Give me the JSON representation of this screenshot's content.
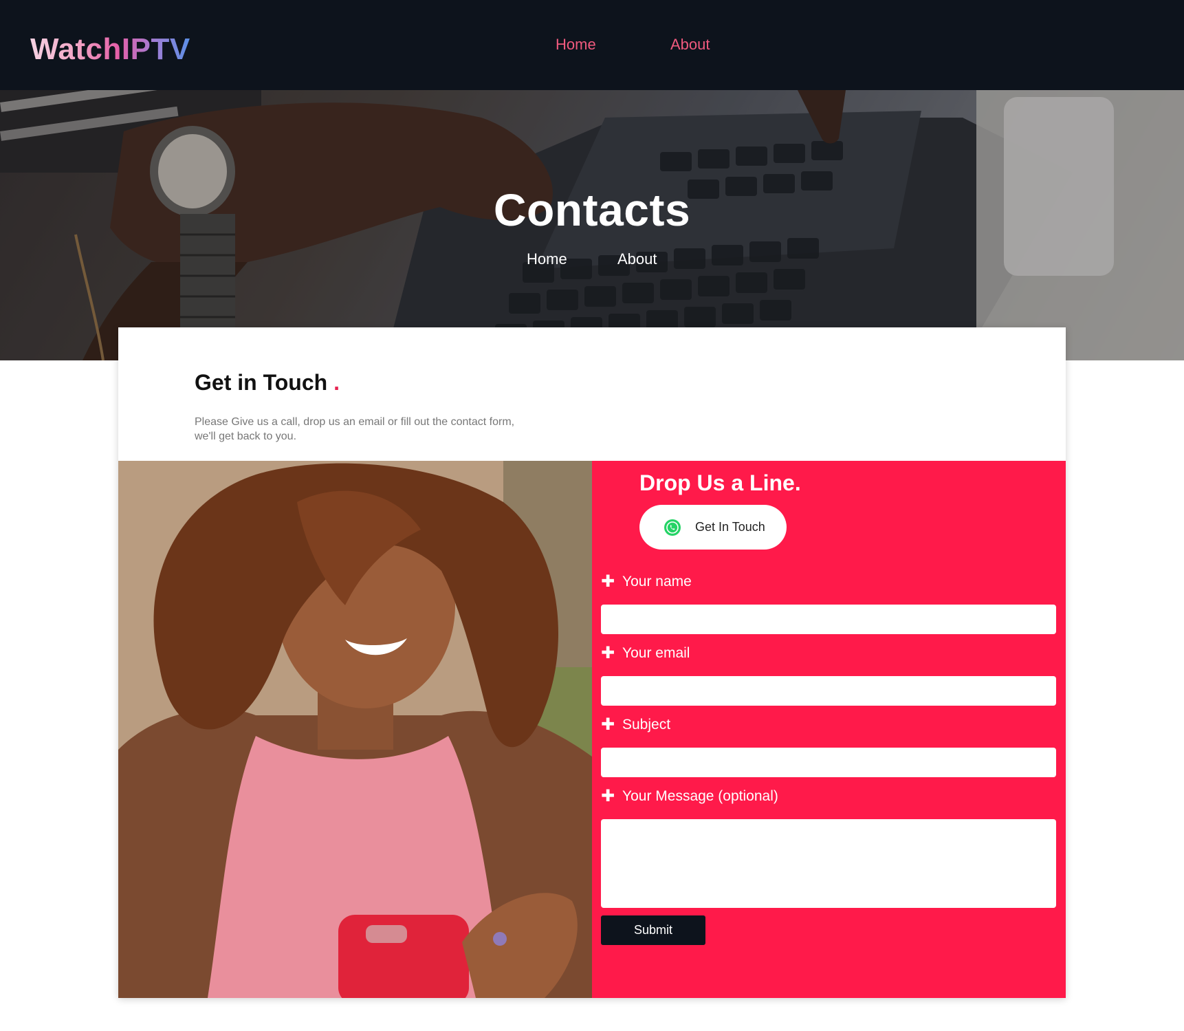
{
  "header": {
    "logo": "WatchIPTV",
    "nav": [
      {
        "label": "Home"
      },
      {
        "label": "About"
      }
    ]
  },
  "hero": {
    "title": "Contacts",
    "links": [
      {
        "label": "Home"
      },
      {
        "label": "About"
      }
    ]
  },
  "contact": {
    "title": "Get in Touch",
    "title_dot": ".",
    "description": "Please Give us a call, drop us an email or fill out the contact form, we'll get back to you."
  },
  "form": {
    "heading": "Drop Us a Line.",
    "whatsapp_button": "Get In Touch",
    "fields": [
      {
        "label": "Your name",
        "value": ""
      },
      {
        "label": "Your email",
        "value": ""
      },
      {
        "label": "Subject",
        "value": ""
      },
      {
        "label": "Your Message (optional)",
        "value": ""
      }
    ],
    "submit_label": "Submit"
  },
  "colors": {
    "header_bg": "#0d131c",
    "nav_link": "#f05a7e",
    "accent": "#ff1a4a",
    "submit_bg": "#0d131c",
    "whatsapp": "#25d366"
  },
  "icons": {
    "whatsapp": "whatsapp-icon",
    "field_marker": "plus-icon"
  }
}
